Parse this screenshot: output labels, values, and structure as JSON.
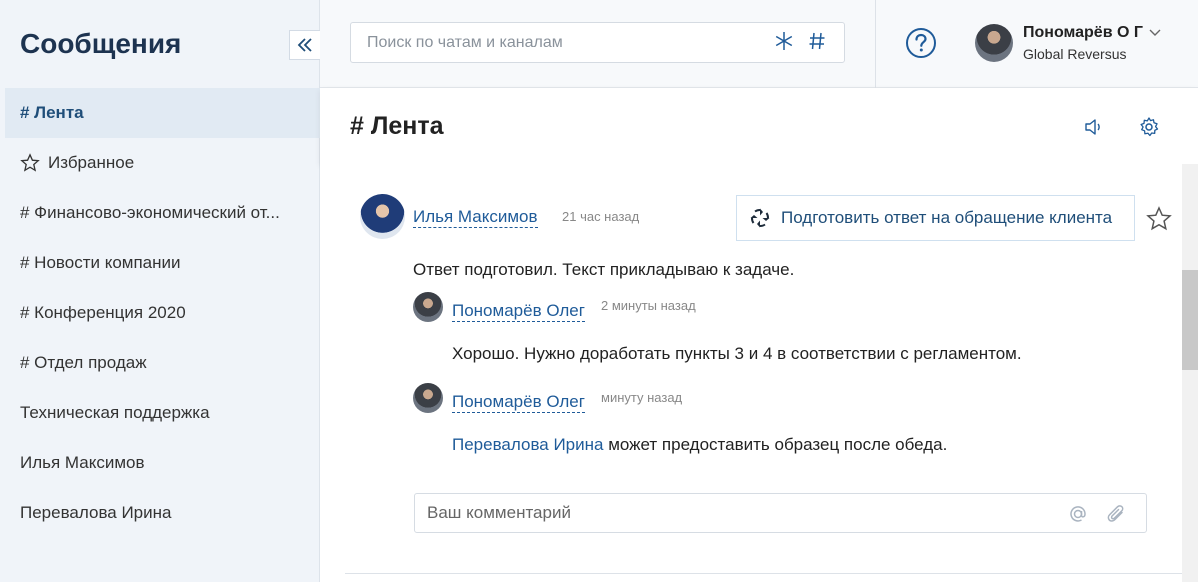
{
  "sidebar": {
    "title": "Сообщения",
    "items": [
      {
        "label": "# Лента"
      },
      {
        "label": "Избранное"
      },
      {
        "label": "# Финансово-экономический от..."
      },
      {
        "label": "# Новости компании"
      },
      {
        "label": "# Конференция 2020"
      },
      {
        "label": "# Отдел продаж"
      },
      {
        "label": "Техническая поддержка"
      },
      {
        "label": "Илья Максимов"
      },
      {
        "label": "Перевалова Ирина"
      }
    ]
  },
  "search": {
    "placeholder": "Поиск по чатам и каналам"
  },
  "user": {
    "name": "Пономарёв О Г",
    "org": "Global Reversus"
  },
  "channel": {
    "title": "# Лента"
  },
  "post": {
    "author": "Илья Максимов",
    "time": "21 час назад",
    "task": "Подготовить ответ на обращение клиента",
    "text": "Ответ подготовил. Текст прикладываю к задаче.",
    "replies": [
      {
        "author": "Пономарёв Олег",
        "time": "2 минуты назад",
        "text": "Хорошо. Нужно доработать пункты 3 и 4 в соответствии с регламентом."
      },
      {
        "author": "Пономарёв Олег",
        "time": "минуту назад",
        "mention": "Перевалова Ирина",
        "text": " может предоставить образец после обеда."
      }
    ]
  },
  "comment": {
    "placeholder": "Ваш комментарий"
  },
  "colors": {
    "accent": "#1f5b99",
    "sidebar_bg": "#f0f4f9",
    "active_item_bg": "#e1eaf3"
  }
}
